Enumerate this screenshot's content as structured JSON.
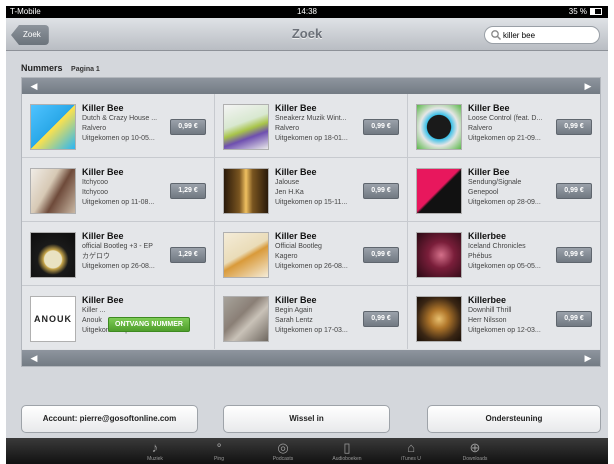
{
  "status_bar": {
    "carrier": "T-Mobile",
    "time": "14:38",
    "battery": "35 %"
  },
  "nav": {
    "back_label": "Zoek",
    "title": "Zoek",
    "search_value": "killer bee"
  },
  "section": {
    "title": "Nummers",
    "page_label": "Pagina 1"
  },
  "results": [
    {
      "title": "Killer Bee",
      "subtitle": "Dutch & Crazy House ...",
      "artist": "Ralvero",
      "released": "Uitgekomen op 10-05...",
      "price": "0,99 €"
    },
    {
      "title": "Killer Bee",
      "subtitle": "Sneakerz Muzik Wint...",
      "artist": "Ralvero",
      "released": "Uitgekomen op 18-01...",
      "price": "0,99 €"
    },
    {
      "title": "Killer Bee",
      "subtitle": "Loose Control (feat. D...",
      "artist": "Ralvero",
      "released": "Uitgekomen op 21-09...",
      "price": "0,99 €"
    },
    {
      "title": "Killer Bee",
      "subtitle": "Itchycoo",
      "artist": "Itchycoo",
      "released": "Uitgekomen op 11-08...",
      "price": "1,29 €"
    },
    {
      "title": "Killer Bee",
      "subtitle": "Jalouse",
      "artist": "Jen H.Ka",
      "released": "Uitgekomen op 15-11...",
      "price": "0,99 €"
    },
    {
      "title": "Killer Bee",
      "subtitle": "Sendung/Signale",
      "artist": "Genepool",
      "released": "Uitgekomen op 28-09...",
      "price": "0,99 €"
    },
    {
      "title": "Killer Bee",
      "subtitle": "official Bootleg +3 - EP",
      "artist": "カゲロウ",
      "released": "Uitgekomen op 26-08...",
      "price": "1,29 €"
    },
    {
      "title": "Killer Bee",
      "subtitle": "Official Bootleg",
      "artist": "Kagero",
      "released": "Uitgekomen op 26-08...",
      "price": "0,99 €"
    },
    {
      "title": "Killerbee",
      "subtitle": "Iceland Chronicles",
      "artist": "Phébus",
      "released": "Uitgekomen op 05-05...",
      "price": "0,99 €"
    },
    {
      "title": "Killer Bee",
      "subtitle": "Killer ...",
      "artist": "Anouk",
      "released": "Uitgekomen op 04-03-2011",
      "action": "ONTVANG NUMMER",
      "cover_text": "ANOUK"
    },
    {
      "title": "Killer Bee",
      "subtitle": "Begin Again",
      "artist": "Sarah Lentz",
      "released": "Uitgekomen op 17-03...",
      "price": "0,99 €"
    },
    {
      "title": "Killerbee",
      "subtitle": "Downhill Thrill",
      "artist": "Herr Nilsson",
      "released": "Uitgekomen op 12-03...",
      "price": "0,99 €"
    }
  ],
  "bottom_buttons": {
    "account": "Account: pierre@gosoftonline.com",
    "redeem": "Wissel in",
    "support": "Ondersteuning"
  },
  "tabs": [
    {
      "icon": "music-icon",
      "label": "Muziek"
    },
    {
      "icon": "genius-icon",
      "label": "Ping"
    },
    {
      "icon": "podcast-icon",
      "label": "Podcasts"
    },
    {
      "icon": "audiobook-icon",
      "label": "Audioboeken"
    },
    {
      "icon": "itunes-u-icon",
      "label": "iTunes U"
    },
    {
      "icon": "download-icon",
      "label": "Downloads"
    }
  ],
  "colors": {
    "accent_green": "#5cb335",
    "nav_gray": "#6c7179",
    "price_gray": "#7d858e"
  }
}
